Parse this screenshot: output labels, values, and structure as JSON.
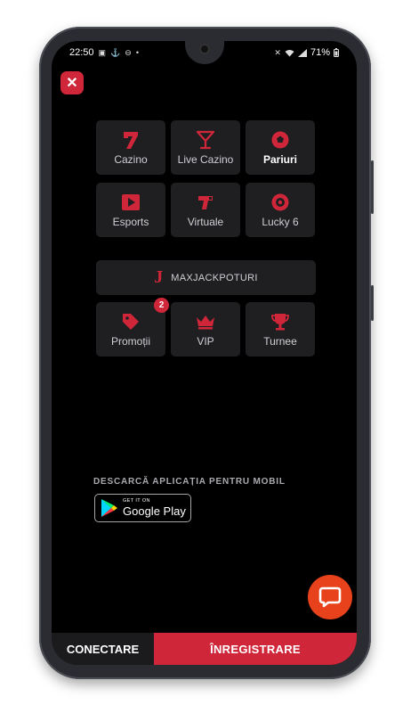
{
  "status_bar": {
    "time": "22:50",
    "battery": "71%",
    "left_icons": [
      "image-icon",
      "anchor-icon",
      "dnd-icon",
      "dot-icon"
    ],
    "right_icons": [
      "mute-icon",
      "wifi-icon",
      "signal-icon",
      "battery-icon"
    ]
  },
  "menu": {
    "row1": [
      {
        "label": "Cazino",
        "icon": "seven-slot-icon"
      },
      {
        "label": "Live Cazino",
        "icon": "cocktail-icon"
      },
      {
        "label": "Pariuri",
        "icon": "football-icon"
      }
    ],
    "row2": [
      {
        "label": "Esports",
        "icon": "play-icon"
      },
      {
        "label": "Virtuale",
        "icon": "virtual-icon"
      },
      {
        "label": "Lucky 6",
        "icon": "lucky-ball-icon"
      }
    ],
    "jackpot": {
      "label": "MAXJACKPOTURI",
      "logo": "J"
    },
    "row3": [
      {
        "label": "Promoții",
        "icon": "tag-icon",
        "badge": "2"
      },
      {
        "label": "VIP",
        "icon": "crown-icon"
      },
      {
        "label": "Turnee",
        "icon": "trophy-icon"
      }
    ]
  },
  "download": {
    "heading": "DESCARCĂ APLICAȚIA PENTRU MOBIL",
    "store_small": "GET IT ON",
    "store_big": "Google Play"
  },
  "bottom": {
    "login": "CONECTARE",
    "register": "ÎNREGISTRARE"
  },
  "colors": {
    "accent": "#d0263a",
    "chat": "#e8421c",
    "tile": "#1f1f22",
    "background": "#000000"
  }
}
